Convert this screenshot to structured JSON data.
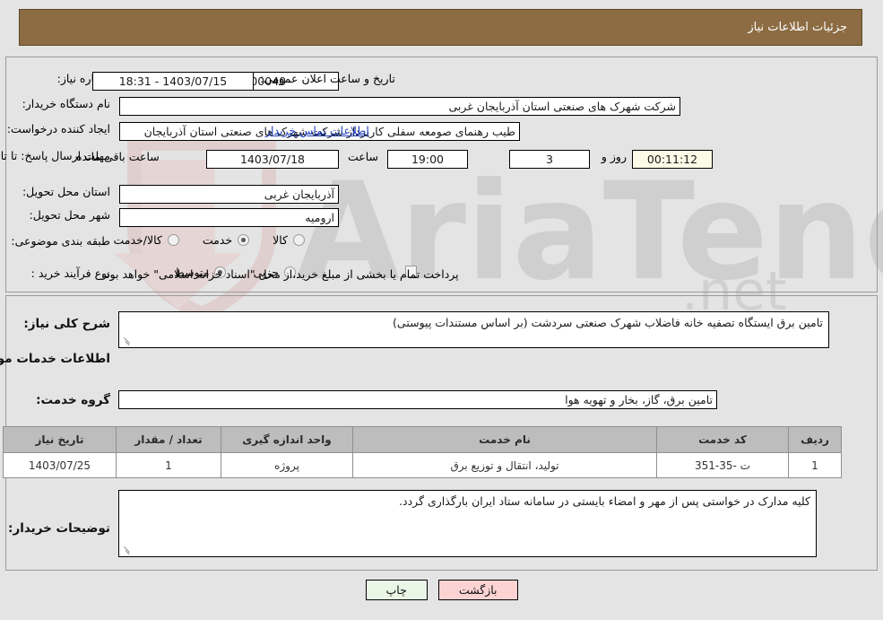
{
  "header": {
    "title": "جزئیات اطلاعات نیاز"
  },
  "fields": {
    "need_number_label": "شماره نیاز:",
    "need_number_value": "1103001526000040",
    "announce_label": "تاریخ و ساعت اعلان عمومی:",
    "announce_value": "1403/07/15 - 18:31",
    "buyer_org_label": "نام دستگاه خریدار:",
    "buyer_org_value": "شرکت شهرک های صنعتی استان آذربایجان غربی",
    "requester_label": "ایجاد کننده درخواست:",
    "requester_value": "طیب رهنمای صومعه سفلی کاربرداز شرکت شهرک های صنعتی استان آذربایجان",
    "contact_link": "اطلاعات تماس خریدار",
    "deadline_label": "مهلت ارسال پاسخ: تا تاریخ:",
    "deadline_date": "1403/07/18",
    "hour_label": "ساعت",
    "hour_value": "19:00",
    "days_value": "3",
    "days_label": "روز و",
    "countdown_value": "00:11:12",
    "countdown_label": "ساعت باقی مانده",
    "province_label": "استان محل تحویل:",
    "province_value": "آذربایجان غربی",
    "city_label": "شهر محل تحویل:",
    "city_value": "ارومیه",
    "category_label": "طبقه بندی موضوعی:",
    "category_options": [
      {
        "label": "کالا",
        "selected": false
      },
      {
        "label": "خدمت",
        "selected": true
      },
      {
        "label": "کالا/خدمت",
        "selected": false
      }
    ],
    "process_label": "نوع فرآیند خرید :",
    "process_options": [
      {
        "label": "جزیی",
        "selected": false
      },
      {
        "label": "متوسط",
        "selected": true
      }
    ],
    "treasury_checkbox_label": "پرداخت تمام یا بخشی از مبلغ خرید،از محل \"اسناد خزانه اسلامی\" خواهد بود.",
    "treasury_checked": false
  },
  "description": {
    "label": "شرح کلی نیاز:",
    "value": "تامین برق ایستگاه تصفیه خانه فاضلاب شهرک صنعتی سردشت (بر اساس مستندات پیوستی)"
  },
  "services_section": {
    "heading": "اطلاعات خدمات مورد نیاز",
    "group_label": "گروه خدمت:",
    "group_value": "تامین برق، گاز، بخار و تهویه هوا"
  },
  "table": {
    "columns": [
      "ردیف",
      "کد خدمت",
      "نام خدمت",
      "واحد اندازه گیری",
      "تعداد / مقدار",
      "تاریخ نیاز"
    ],
    "rows": [
      {
        "row_no": "1",
        "service_code": "ت -35-351",
        "service_name": "تولید، انتقال و توزیع برق",
        "unit": "پروژه",
        "quantity": "1",
        "need_date": "1403/07/25"
      }
    ]
  },
  "buyer_notes": {
    "label": "توضیحات خریدار:",
    "value": "کلیه مدارک در خواستی پس از مهر و امضاء بایستی در سامانه ستاد ایران بارگذاری گردد."
  },
  "buttons": {
    "print": "چاپ",
    "back": "بازگشت"
  },
  "watermark": {
    "text": "AriaTender.net"
  },
  "colors": {
    "header_bg": "#8d6c43",
    "link": "#1d3fbe",
    "print_btn": "#e9f6e6",
    "back_btn": "#fbd3d3",
    "table_header": "#bdbdbd",
    "countdown_bg": "#fbfbe8"
  }
}
